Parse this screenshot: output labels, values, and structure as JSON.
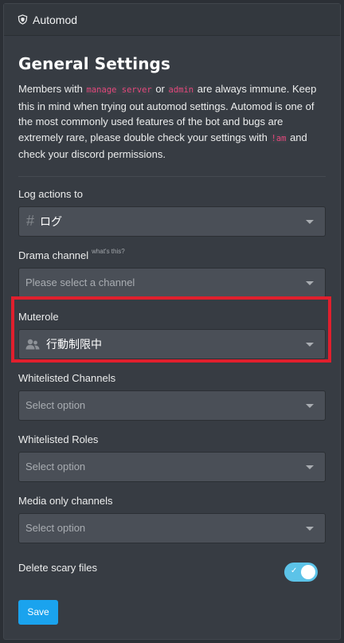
{
  "header": {
    "title": "Automod",
    "icon": "shield-icon"
  },
  "main": {
    "title": "General Settings",
    "intro": {
      "t1": "Members with ",
      "code1": "manage server",
      "t2": " or ",
      "code2": "admin",
      "t3": " are always immune. Keep this in mind when trying out automod settings. Automod is one of the most commonly used features of the bot and bugs are extremely rare, please double check your settings with ",
      "code3": "!am",
      "t4": " and check your discord permissions."
    },
    "log_actions": {
      "label": "Log actions to",
      "value": "ログ",
      "icon": "hash-icon"
    },
    "drama_channel": {
      "label": "Drama channel",
      "hint": "what's this?",
      "placeholder": "Please select a channel"
    },
    "muterole": {
      "label": "Muterole",
      "value": "行動制限中",
      "icon": "user-icon"
    },
    "whitelisted_channels": {
      "label": "Whitelisted Channels",
      "placeholder": "Select option"
    },
    "whitelisted_roles": {
      "label": "Whitelisted Roles",
      "placeholder": "Select option"
    },
    "media_only": {
      "label": "Media only channels",
      "placeholder": "Select option"
    },
    "delete_scary": {
      "label": "Delete scary files",
      "enabled": true
    },
    "save_label": "Save"
  },
  "colors": {
    "accent": "#1aa3ee",
    "toggle_on": "#5cc3e8",
    "highlight": "#e01f2d",
    "code": "#e4487c"
  }
}
